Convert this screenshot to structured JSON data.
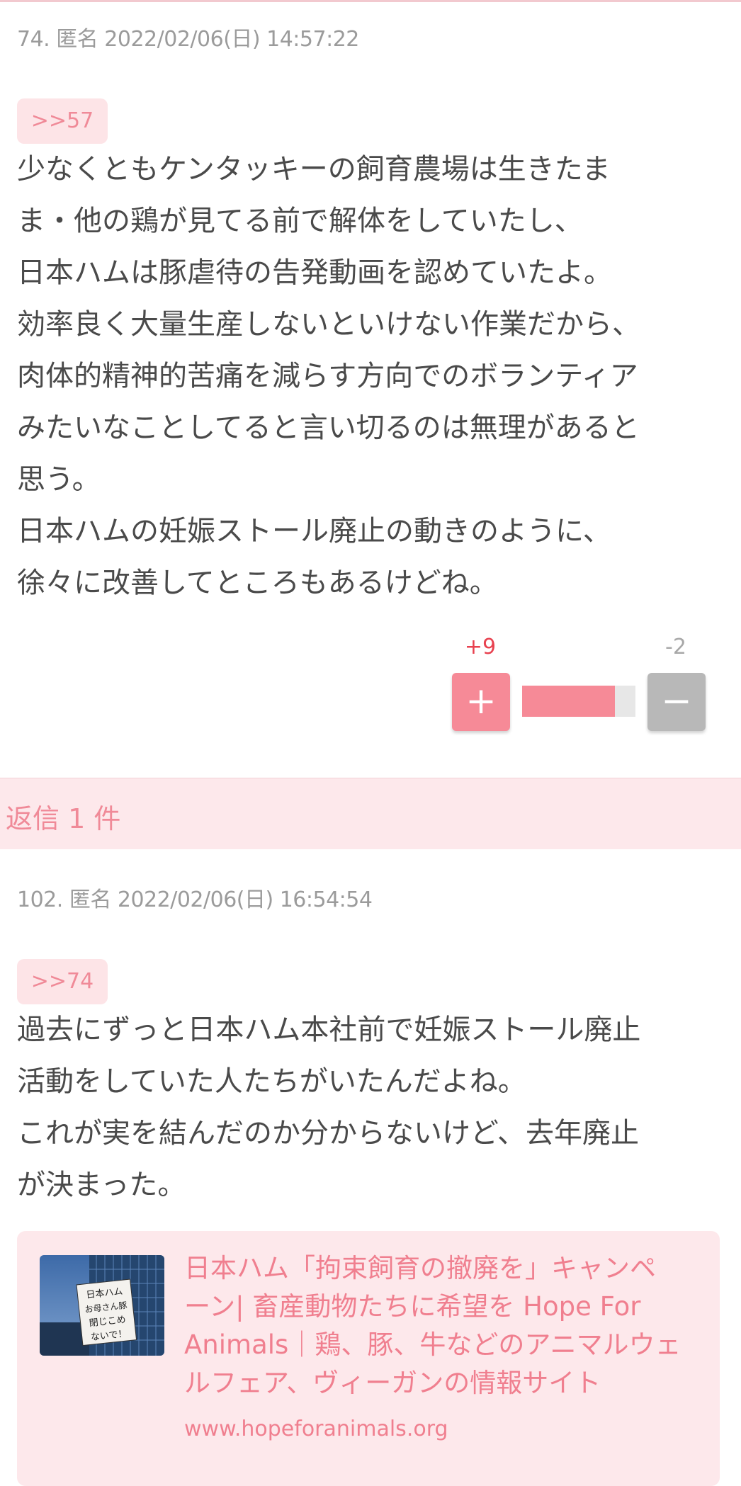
{
  "comments": [
    {
      "meta": "74. 匿名 2022/02/06(日) 14:57:22",
      "anchor": ">>57",
      "body": [
        "少なくともケンタッキーの飼育農場は生きたま",
        "ま・他の鶏が見てる前で解体をしていたし、",
        "日本ハムは豚虐待の告発動画を認めていたよ。",
        "効率良く大量生産しないといけない作業だから、",
        "肉体的精神的苦痛を減らす方向でのボランティア",
        "みたいなことしてると言い切るのは無理があると",
        "思う。",
        "日本ハムの妊娠ストール廃止の動きのように、",
        "徐々に改善してところもあるけどね。"
      ],
      "votes": {
        "plus": "+9",
        "minus": "-2",
        "plus_label": "+",
        "minus_label": "−",
        "ratio": 0.82
      }
    },
    {
      "meta": "102. 匿名 2022/02/06(日) 16:54:54",
      "anchor": ">>74",
      "body": [
        "過去にずっと日本ハム本社前で妊娠ストール廃止",
        "活動をしていた人たちがいたんだよね。",
        "これが実を結んだのか分からないけど、去年廃止",
        "が決まった。"
      ]
    }
  ],
  "reply_bar": {
    "label": "返信 1 件"
  },
  "link_card": {
    "title": [
      "日本ハム「拘束飼育の撤廃を」キャンペ",
      "ーン| 畜産動物たちに希望を Hope For",
      "Animals｜鶏、豚、牛などのアニマルウェ",
      "ルフェア、ヴィーガンの情報サイト"
    ],
    "url": "www.hopeforanimals.org",
    "thumbnail_sign": [
      "日本ハム",
      "お母さん豚",
      "閉じこめ",
      "ないで！"
    ]
  },
  "colors": {
    "accent": "#f68a97",
    "accent_text": "#f08a98",
    "plus_count": "#e8414f",
    "minus": "#b8b8b8",
    "meta_text": "#9b9b9b",
    "body_text": "#4a4a4a",
    "card_bg": "#fde8eb"
  }
}
